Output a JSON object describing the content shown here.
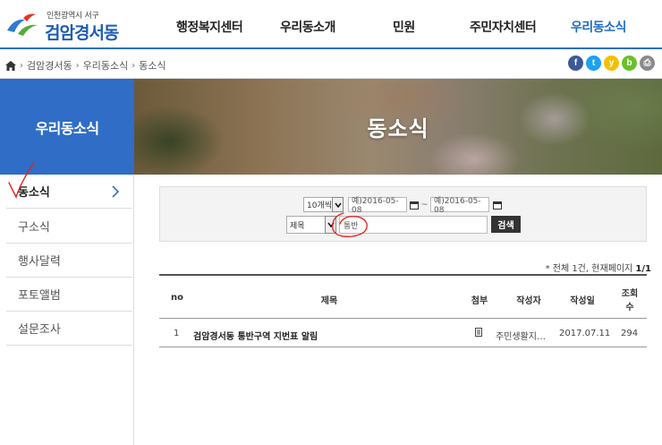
{
  "header": {
    "logo_sub": "인천광역시 서구",
    "logo_title": "검암경서동",
    "nav": [
      "행정복지센터",
      "우리동소개",
      "민원",
      "주민자치센터",
      "우리동소식"
    ]
  },
  "breadcrumb": [
    "검암경서동",
    "우리동소식",
    "동소식"
  ],
  "sns": [
    {
      "glyph": "f",
      "color": "#3b5998"
    },
    {
      "glyph": "t",
      "color": "#1da1f2"
    },
    {
      "glyph": "y",
      "color": "#f5c000"
    },
    {
      "glyph": "b",
      "color": "#6cbf2c"
    },
    {
      "glyph": "⎙",
      "color": "#8a8a8a"
    }
  ],
  "side_title": "우리동소식",
  "hero_title": "동소식",
  "lnb": [
    "동소식",
    "구소식",
    "행사달력",
    "포토앨범",
    "설문조사"
  ],
  "search": {
    "page_size": "10개씩",
    "date_start": "예)2016-05-08",
    "date_end": "예)2016-05-08",
    "tilde": "~",
    "field": "제목",
    "keyword": "통반",
    "button": "검색"
  },
  "total": {
    "prefix": "* 전체 1건, 현재페이지 ",
    "page": "1/1"
  },
  "table": {
    "headers": {
      "no": "no",
      "title": "제목",
      "attach": "첨부",
      "author": "작성자",
      "date": "작성일",
      "views_1": "조회",
      "views_2": "수"
    },
    "rows": [
      {
        "no": "1",
        "title": "검암경서동 통반구역 지번표 알림",
        "attach_icon": "document-icon",
        "author": "주민생활지…",
        "date": "2017.07.11",
        "views": "294"
      }
    ]
  },
  "colors": {
    "brand": "#2f6dc6",
    "nav_active": "#1d6cc8",
    "annotation": "#e2231a"
  }
}
